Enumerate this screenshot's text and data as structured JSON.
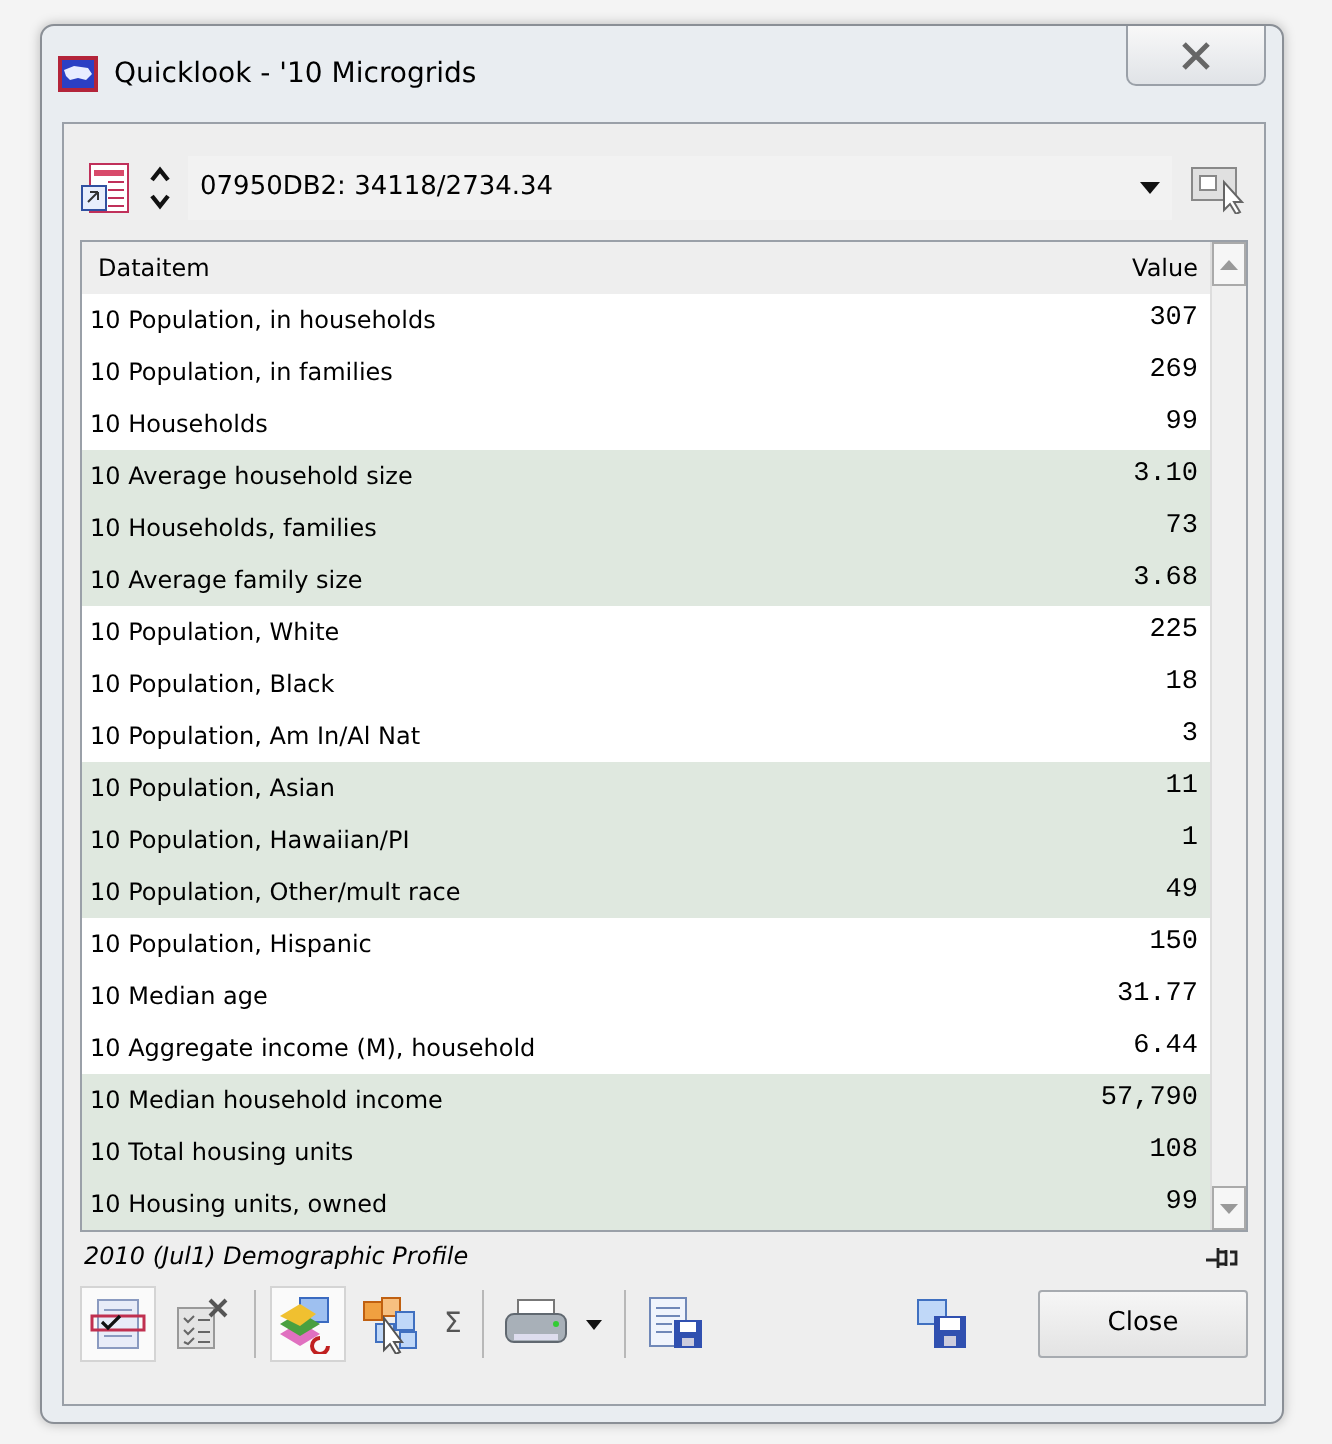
{
  "window": {
    "title": "Quicklook - '10 Microgrids"
  },
  "selector": {
    "value": "07950DB2: 34118/2734.34"
  },
  "table": {
    "columns": [
      "Dataitem",
      "Value"
    ],
    "rows": [
      {
        "item": "10 Population, in households",
        "value": "307",
        "shaded": false
      },
      {
        "item": "10 Population, in families",
        "value": "269",
        "shaded": false
      },
      {
        "item": "10 Households",
        "value": "99",
        "shaded": false
      },
      {
        "item": "10 Average household size",
        "value": "3.10",
        "shaded": true
      },
      {
        "item": "10 Households, families",
        "value": "73",
        "shaded": true
      },
      {
        "item": "10 Average family size",
        "value": "3.68",
        "shaded": true
      },
      {
        "item": "10 Population, White",
        "value": "225",
        "shaded": false
      },
      {
        "item": "10 Population, Black",
        "value": "18",
        "shaded": false
      },
      {
        "item": "10 Population, Am In/Al Nat",
        "value": "3",
        "shaded": false
      },
      {
        "item": "10 Population, Asian",
        "value": "11",
        "shaded": true
      },
      {
        "item": "10 Population, Hawaiian/PI",
        "value": "1",
        "shaded": true
      },
      {
        "item": "10 Population, Other/mult race",
        "value": "49",
        "shaded": true
      },
      {
        "item": "10 Population, Hispanic",
        "value": "150",
        "shaded": false
      },
      {
        "item": "10 Median age",
        "value": "31.77",
        "shaded": false
      },
      {
        "item": "10 Aggregate income (M), household",
        "value": "6.44",
        "shaded": false
      },
      {
        "item": "10 Median household income",
        "value": "57,790",
        "shaded": true
      },
      {
        "item": "10 Total housing units",
        "value": "108",
        "shaded": true
      },
      {
        "item": "10 Housing units, owned",
        "value": "99",
        "shaded": true
      }
    ]
  },
  "status_text": "2010 (Jul1) Demographic Profile",
  "toolbar": [
    {
      "kind": "checklist",
      "selected": true
    },
    {
      "kind": "clearlist",
      "selected": false
    },
    {
      "kind": "sep"
    },
    {
      "kind": "layers",
      "selected": true
    },
    {
      "kind": "blocks",
      "selected": false
    },
    {
      "kind": "sigma",
      "label": "Σ"
    },
    {
      "kind": "sep"
    },
    {
      "kind": "print"
    },
    {
      "kind": "sep"
    },
    {
      "kind": "save"
    }
  ],
  "close_button": "Close"
}
